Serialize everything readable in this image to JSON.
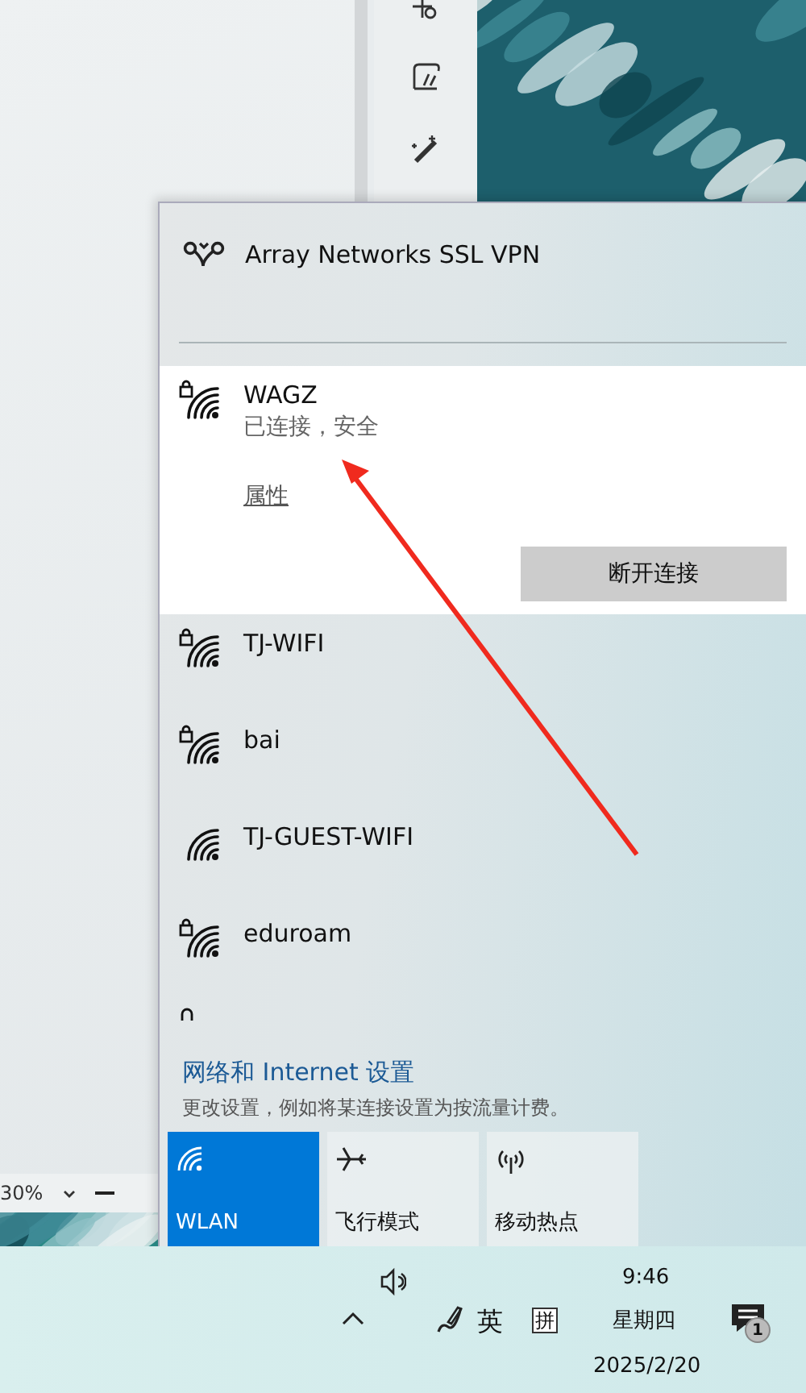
{
  "background": {
    "zoom_reading": "30%"
  },
  "flyout": {
    "vpn": {
      "name": "Array Networks SSL VPN"
    },
    "networks": [
      {
        "name": "WAGZ",
        "secured": true,
        "selected": true,
        "status": "已连接，安全",
        "properties_link": "属性",
        "action": "断开连接"
      },
      {
        "name": "TJ-WIFI",
        "secured": true,
        "selected": false
      },
      {
        "name": "bai",
        "secured": true,
        "selected": false
      },
      {
        "name": "TJ-GUEST-WIFI",
        "secured": false,
        "selected": false
      },
      {
        "name": "eduroam",
        "secured": true,
        "selected": false
      }
    ],
    "settings": {
      "title": "网络和 Internet 设置",
      "description": "更改设置，例如将某连接设置为按流量计费。"
    },
    "tiles": [
      {
        "kind": "wifi",
        "label": "WLAN",
        "on": true
      },
      {
        "kind": "airplane",
        "label": "飞行模式",
        "on": false
      },
      {
        "kind": "hotspot",
        "label": "移动热点",
        "on": false
      }
    ]
  },
  "taskbar": {
    "ime_mode": "英",
    "ime_icon": "拼",
    "time": "9:46",
    "weekday": "星期四",
    "date": "2025/2/20",
    "notification_count": "1"
  }
}
